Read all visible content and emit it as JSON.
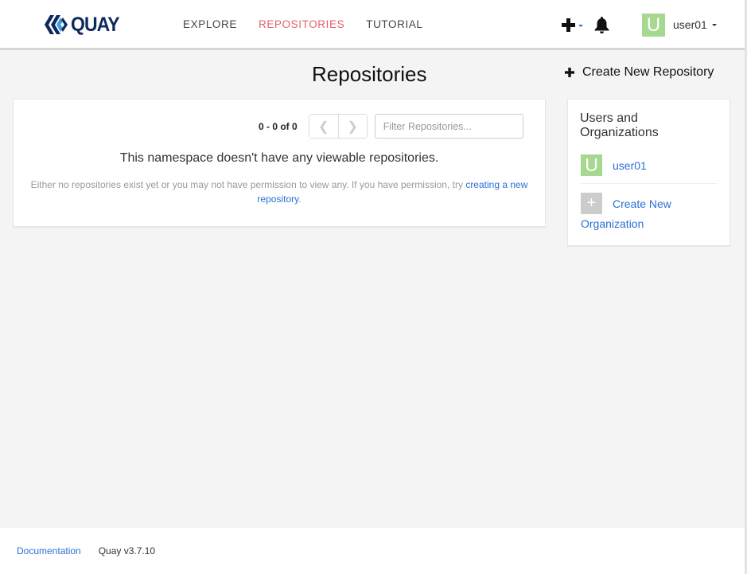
{
  "header": {
    "logo_text": "QUAY",
    "nav": [
      {
        "label": "EXPLORE",
        "active": false
      },
      {
        "label": "REPOSITORIES",
        "active": true
      },
      {
        "label": "TUTORIAL",
        "active": false
      }
    ],
    "user": {
      "avatar_letter": "U",
      "name": "user01"
    }
  },
  "main": {
    "title": "Repositories",
    "create_repo_label": "Create New Repository",
    "pagination": {
      "count_text": "0 - 0 of 0",
      "prev_glyph": "❮",
      "next_glyph": "❯"
    },
    "filter": {
      "placeholder": "Filter Repositories...",
      "value": ""
    },
    "empty_title": "This namespace doesn't have any viewable repositories.",
    "empty_desc": "Either no repositories exist yet or you may not have permission to view any. If you have permission, try ",
    "empty_link": "creating a new repository",
    "empty_desc_end": "."
  },
  "sidebar": {
    "title": "Users and Organizations",
    "user": {
      "avatar_letter": "U",
      "name": "user01"
    },
    "create_org_icon": "+",
    "create_org_label": "Create New Organization"
  },
  "footer": {
    "documentation_label": "Documentation",
    "version": "Quay v3.7.10"
  },
  "colors": {
    "accent_active_nav": "#e5616e",
    "link": "#2b6fd6",
    "avatar": "#a6d98f",
    "logo_dark": "#0d2a5c",
    "logo_light": "#3c9ee6"
  }
}
